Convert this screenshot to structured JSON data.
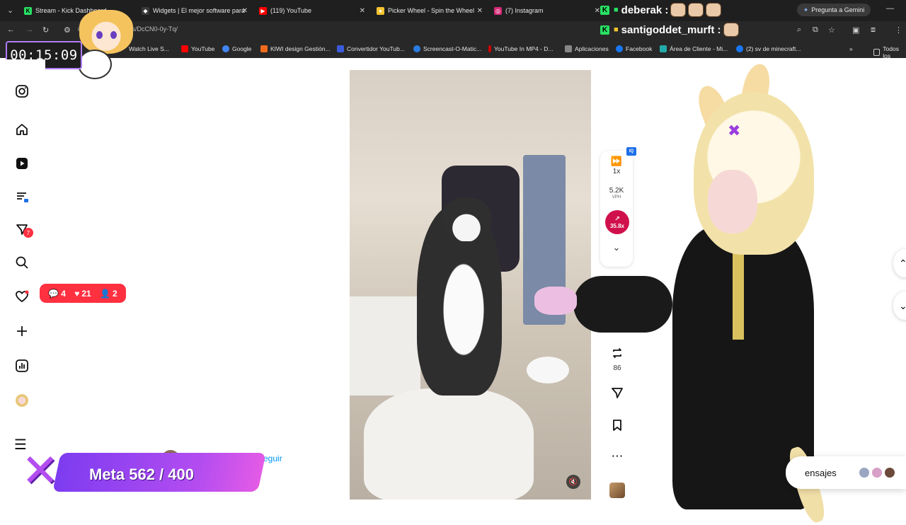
{
  "browser": {
    "tabs": [
      {
        "label": "Stream - Kick Dashboard",
        "fav": "K",
        "fav_color": "#28e063",
        "fav_text": "#000"
      },
      {
        "label": "Widgets | El mejor software para",
        "fav": "◆",
        "fav_color": "#3a3a3a",
        "fav_text": "#fff"
      },
      {
        "label": "(119) YouTube",
        "fav": "▶",
        "fav_color": "#ff0000",
        "fav_text": "#fff"
      },
      {
        "label": "Picker Wheel - Spin the Wheel",
        "fav": "●",
        "fav_color": "#f4c430",
        "fav_text": "#7a5"
      },
      {
        "label": "(7) Instagram",
        "fav": "◎",
        "fav_color": "#d62976",
        "fav_text": "#fff"
      }
    ],
    "gemini_label": "Pregunta a Gemini",
    "url": "instagram.com/reels/DcCN0-0y-Tq/",
    "bookmarks": [
      {
        "label": "Watch Live S...",
        "color": "#e84"
      },
      {
        "label": "YouTube",
        "color": "#ff0000"
      },
      {
        "label": "Google",
        "color": "#4285f4"
      },
      {
        "label": "KIWI design Gestión...",
        "color": "#f36b1c"
      },
      {
        "label": "Convertidor YouTub...",
        "color": "#3b5bdb"
      },
      {
        "label": "Screencast-O-Matic...",
        "color": "#2a7de1"
      },
      {
        "label": "YouTube In MP4 - D...",
        "color": "#c00"
      },
      {
        "label": "Aplicaciones",
        "color": "#888"
      },
      {
        "label": "Facebook",
        "color": "#1877f2"
      },
      {
        "label": "Área de Cliente - Mi...",
        "color": "#2aa"
      },
      {
        "label": "(2) sv de minecraft...",
        "color": "#1877f2"
      }
    ],
    "all_bookmarks_label": "Todos los"
  },
  "overlay": {
    "timer": "00:15:09",
    "chat_line_1": "deberak :",
    "chat_line_2": "santigoddet_murft :",
    "goal": "Meta 562 / 400"
  },
  "sidebar": {
    "notifications_badge": "7",
    "activity": {
      "comments": "4",
      "likes": "21",
      "followers": "2"
    }
  },
  "reel": {
    "speed": "1x",
    "vph_value": "5.2K",
    "vph_label": "VPH",
    "boost_value": "35.8x",
    "reposts_count": "86",
    "follow_label": "Seguir"
  },
  "messages": {
    "label": "ensajes"
  },
  "colors": {
    "instagram_red": "#ff3040",
    "follow_blue": "#0095f6",
    "boost_crimson": "#d0104c",
    "goal_purple": "#7d3cf0"
  }
}
